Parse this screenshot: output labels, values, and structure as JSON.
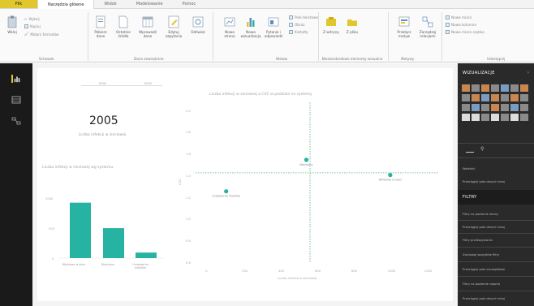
{
  "tabs": {
    "file": "Plik",
    "items": [
      "Narzędzia główne",
      "Widok",
      "Modelowanie",
      "Pomoc"
    ],
    "active_index": 0
  },
  "ribbon": {
    "clipboard": {
      "paste": "Wklej",
      "cut": "Wytnij",
      "copy": "Kopiuj",
      "format_painter": "Malarz formatów",
      "group": "Schowek"
    },
    "external_data": {
      "buttons": [
        "Pobierz dane",
        "Ostatnie źródła",
        "Wprowadź dane",
        "Edytuj zapytania",
        "Odśwież"
      ],
      "group": "Dane zewnętrzne"
    },
    "insert": {
      "buttons": [
        "Nowa strona",
        "Nowa wizualizacja",
        "Pytanie i odpowiedź",
        "Przyciski"
      ],
      "small": [
        "Pole tekstowe",
        "Obraz",
        "Kształty"
      ],
      "group": "Wstaw"
    },
    "custom_visuals": {
      "buttons": [
        "Z witryny",
        "Z pliku"
      ],
      "group": "Niestandardowe elementy wizualne"
    },
    "themes": {
      "buttons": [
        "Przełącz motyw",
        "Zarządzaj relacjami"
      ],
      "group": "Motywy"
    },
    "share": {
      "buttons": [
        "Nowa miara",
        "Nowa kolumna",
        "Nowa miara szybka"
      ],
      "group": "Udostępnij"
    }
  },
  "report": {
    "slicer": {
      "min": "0000",
      "max": "0000"
    },
    "card": {
      "value": "2005",
      "label": "Liczba infekcji w sieciowej"
    },
    "bar_visual": {
      "title": "Liczba infekcji w sieciowej wg systemu",
      "y_ticks": [
        "1000",
        "500",
        "0"
      ],
      "categories": [
        "Windows w sieci",
        "Nieznany",
        "Urządzenia mobilne"
      ],
      "values": [
        1000,
        540,
        100
      ],
      "ylim": [
        0,
        1200
      ],
      "color": "#26b3a1"
    },
    "scatter_visual": {
      "title": "Liczba infekcji w sieciowej a CVC w podziale na systemy",
      "y_ticks": [
        "2.0",
        "1.8",
        "1.6",
        "1.4",
        "1.2",
        "1.0",
        "0.8",
        "0.6"
      ],
      "x_ticks": [
        "0",
        "200",
        "400",
        "600",
        "800",
        "1000",
        "1200"
      ],
      "y_axis_label": "CVC",
      "x_axis_label": "Liczba infekcji w sieciowej",
      "points": [
        {
          "label": "Nieznany",
          "x": 540,
          "y": 1.55
        },
        {
          "label": "Windows w sieci",
          "x": 1000,
          "y": 1.41
        },
        {
          "label": "Urządzenia mobilne",
          "x": 100,
          "y": 1.26
        }
      ],
      "xlim": [
        -50,
        1250
      ],
      "ylim": [
        0.6,
        2.05
      ],
      "ref_x": 560,
      "ref_y": 1.43,
      "color": "#26b3a1"
    }
  },
  "visualizations_pane": {
    "title": "WIZUALIZACJE",
    "field_label": "Wartości",
    "field_hint": "Przeciągnij pola danych tutaj"
  },
  "filters_pane": {
    "title": "FILTRY",
    "items": [
      "Filtry na poziomie strony",
      "Przeciągnij pola danych tutaj",
      "Filtry przekazywania",
      "Zachowaj wszystkie filtry",
      "Przeciągnij pola szczegółowe",
      "Filtry na poziomie raportu",
      "Przeciągnij pola danych tutaj"
    ]
  },
  "colors": {
    "accent": "#e1c72e",
    "teal": "#26b3a1",
    "pane": "#2a2a2a"
  }
}
